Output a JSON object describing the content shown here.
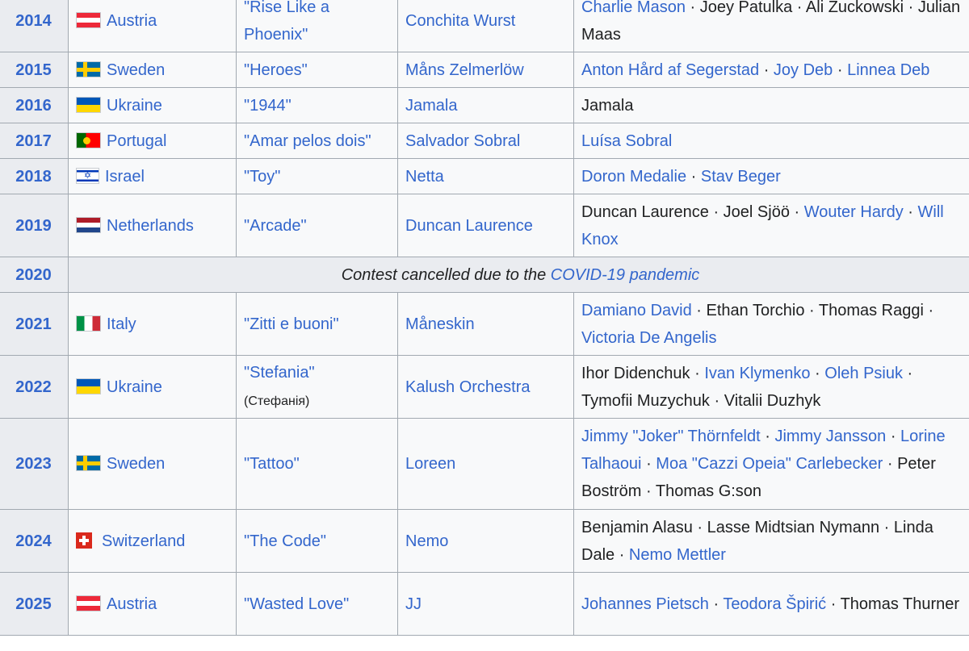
{
  "sep": " · ",
  "rows": [
    {
      "year": "2014",
      "flag": "at",
      "country": "Austria",
      "song": "\"Rise Like a Phoenix\"",
      "artist": "Conchita Wurst",
      "writers": [
        {
          "name": "Charlie Mason",
          "link": true
        },
        {
          "name": "Joey Patulka",
          "link": false
        },
        {
          "name": "Ali Zuckowski",
          "link": false
        },
        {
          "name": "Julian Maas",
          "link": false
        }
      ]
    },
    {
      "year": "2015",
      "flag": "se",
      "country": "Sweden",
      "song": "\"Heroes\"",
      "artist": "Måns Zelmerlöw",
      "writers": [
        {
          "name": "Anton Hård af Segerstad",
          "link": true
        },
        {
          "name": "Joy Deb",
          "link": true
        },
        {
          "name": "Linnea Deb",
          "link": true
        }
      ]
    },
    {
      "year": "2016",
      "flag": "ua",
      "country": "Ukraine",
      "song": "\"1944\"",
      "artist": "Jamala",
      "writers": [
        {
          "name": "Jamala",
          "link": false
        }
      ]
    },
    {
      "year": "2017",
      "flag": "pt",
      "country": "Portugal",
      "song": "\"Amar pelos dois\"",
      "artist": "Salvador Sobral",
      "writers": [
        {
          "name": "Luísa Sobral",
          "link": true
        }
      ]
    },
    {
      "year": "2018",
      "flag": "il",
      "country": "Israel",
      "song": "\"Toy\"",
      "artist": "Netta",
      "writers": [
        {
          "name": "Doron Medalie",
          "link": true
        },
        {
          "name": "Stav Beger",
          "link": true
        }
      ]
    },
    {
      "year": "2019",
      "flag": "nl",
      "country": "Netherlands",
      "song": "\"Arcade\"",
      "artist": "Duncan Laurence",
      "writers": [
        {
          "name": "Duncan Laurence",
          "link": false
        },
        {
          "name": "Joel Sjöö",
          "link": false
        },
        {
          "name": "Wouter Hardy",
          "link": true
        },
        {
          "name": "Will Knox",
          "link": true
        }
      ]
    },
    {
      "year": "2020",
      "cancelled": true,
      "cancel_text": "Contest cancelled due to the ",
      "cancel_link": "COVID-19 pandemic"
    },
    {
      "year": "2021",
      "flag": "it",
      "country": "Italy",
      "song": "\"Zitti e buoni\"",
      "artist": "Måneskin",
      "writers": [
        {
          "name": "Damiano David",
          "link": true
        },
        {
          "name": "Ethan Torchio",
          "link": false
        },
        {
          "name": "Thomas Raggi",
          "link": false
        },
        {
          "name": "Victoria De Angelis",
          "link": true
        }
      ]
    },
    {
      "year": "2022",
      "flag": "ua",
      "country": "Ukraine",
      "song": "\"Stefania\"",
      "song_alt": "(Стефанія)",
      "artist": "Kalush Orchestra",
      "writers": [
        {
          "name": "Ihor Didenchuk",
          "link": false
        },
        {
          "name": "Ivan Klymenko",
          "link": true
        },
        {
          "name": "Oleh Psiuk",
          "link": true
        },
        {
          "name": "Tymofii Muzychuk",
          "link": false
        },
        {
          "name": "Vitalii Duzhyk",
          "link": false
        }
      ]
    },
    {
      "year": "2023",
      "flag": "se",
      "country": "Sweden",
      "song": "\"Tattoo\"",
      "artist": "Loreen",
      "writers": [
        {
          "name": "Jimmy \"Joker\" Thörnfeldt",
          "link": true
        },
        {
          "name": "Jimmy Jansson",
          "link": true
        },
        {
          "name": "Lorine Talhaoui",
          "link": true
        },
        {
          "name": "Moa \"Cazzi Opeia\" Carlebecker",
          "link": true
        },
        {
          "name": "Peter Boström",
          "link": false
        },
        {
          "name": "Thomas G:son",
          "link": false
        }
      ]
    },
    {
      "year": "2024",
      "flag": "ch",
      "country": "Switzerland",
      "song": "\"The Code\"",
      "artist": "Nemo",
      "writers": [
        {
          "name": "Benjamin Alasu",
          "link": false
        },
        {
          "name": "Lasse Midtsian Nymann",
          "link": false
        },
        {
          "name": "Linda Dale",
          "link": false
        },
        {
          "name": "Nemo Mettler",
          "link": true
        }
      ]
    },
    {
      "year": "2025",
      "flag": "at",
      "country": "Austria",
      "song": "\"Wasted Love\"",
      "artist": "JJ",
      "writers": [
        {
          "name": "Johannes Pietsch",
          "link": true
        },
        {
          "name": "Teodora Špirić",
          "link": true
        },
        {
          "name": "Thomas Thurner",
          "link": false
        }
      ]
    }
  ]
}
